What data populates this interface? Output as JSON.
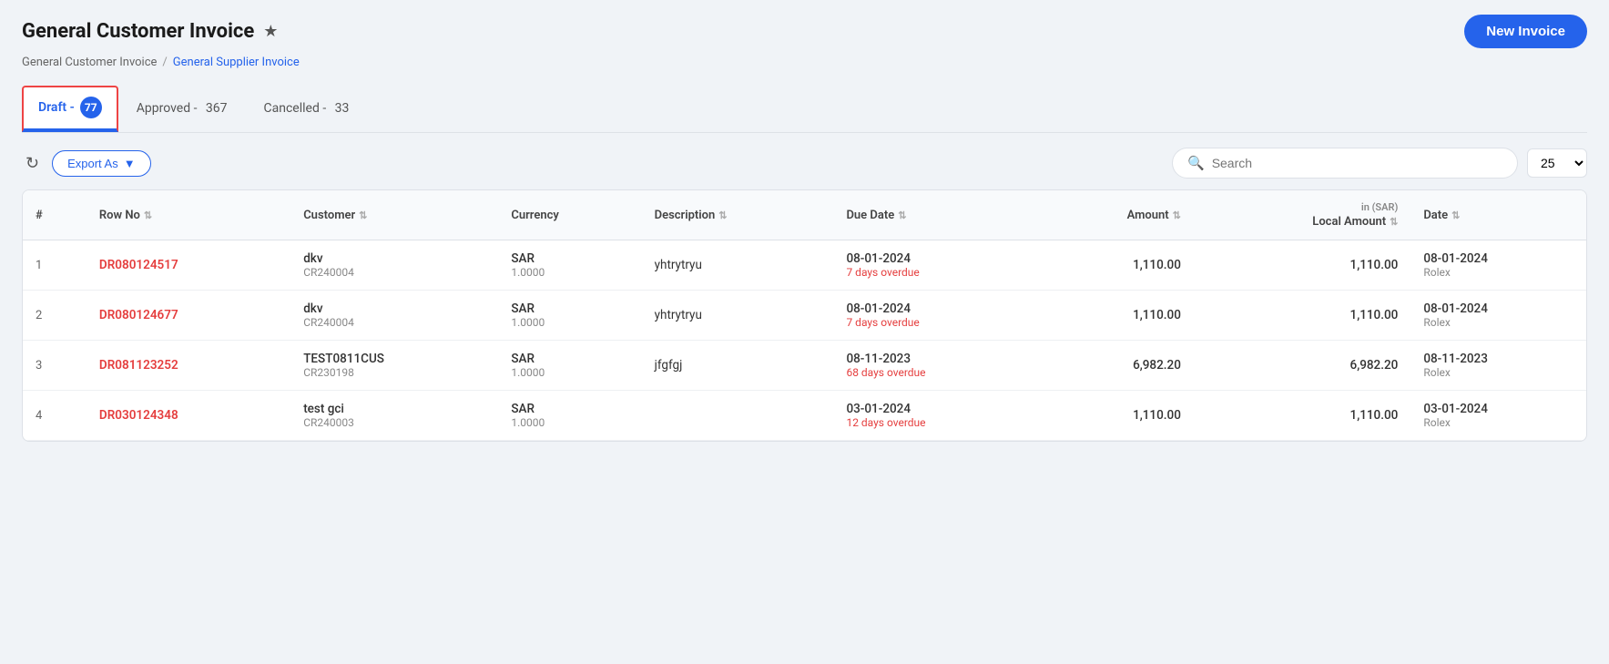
{
  "page": {
    "title": "General Customer Invoice",
    "star": "★",
    "new_invoice_label": "New Invoice"
  },
  "breadcrumb": {
    "current": "General Customer Invoice",
    "separator": "/",
    "link_label": "General Supplier Invoice"
  },
  "tabs": [
    {
      "id": "draft",
      "label": "Draft -",
      "count": "77",
      "active": true
    },
    {
      "id": "approved",
      "label": "Approved -",
      "count": "367",
      "active": false
    },
    {
      "id": "cancelled",
      "label": "Cancelled -",
      "count": "33",
      "active": false
    }
  ],
  "toolbar": {
    "export_label": "Export As",
    "search_placeholder": "Search",
    "per_page": "25"
  },
  "table": {
    "sar_header": "in (SAR)",
    "columns": [
      "#",
      "Row No",
      "Customer",
      "Currency",
      "Description",
      "Due Date",
      "Amount",
      "Local Amount",
      "Date"
    ],
    "rows": [
      {
        "num": "1",
        "row_no": "DR080124517",
        "customer_name": "dkv",
        "customer_id": "CR240004",
        "currency_code": "SAR",
        "currency_rate": "1.0000",
        "description": "yhtrytryu",
        "due_date": "08-01-2024",
        "overdue": "7 days overdue",
        "amount": "1,110.00",
        "local_amount": "1,110.00",
        "date": "08-01-2024",
        "date_sub": "Rolex"
      },
      {
        "num": "2",
        "row_no": "DR080124677",
        "customer_name": "dkv",
        "customer_id": "CR240004",
        "currency_code": "SAR",
        "currency_rate": "1.0000",
        "description": "yhtrytryu",
        "due_date": "08-01-2024",
        "overdue": "7 days overdue",
        "amount": "1,110.00",
        "local_amount": "1,110.00",
        "date": "08-01-2024",
        "date_sub": "Rolex"
      },
      {
        "num": "3",
        "row_no": "DR081123252",
        "customer_name": "TEST0811CUS",
        "customer_id": "CR230198",
        "currency_code": "SAR",
        "currency_rate": "1.0000",
        "description": "jfgfgj",
        "due_date": "08-11-2023",
        "overdue": "68 days overdue",
        "amount": "6,982.20",
        "local_amount": "6,982.20",
        "date": "08-11-2023",
        "date_sub": "Rolex"
      },
      {
        "num": "4",
        "row_no": "DR030124348",
        "customer_name": "test gci",
        "customer_id": "CR240003",
        "currency_code": "SAR",
        "currency_rate": "1.0000",
        "description": "",
        "due_date": "03-01-2024",
        "overdue": "12 days overdue",
        "amount": "1,110.00",
        "local_amount": "1,110.00",
        "date": "03-01-2024",
        "date_sub": "Rolex"
      }
    ]
  }
}
